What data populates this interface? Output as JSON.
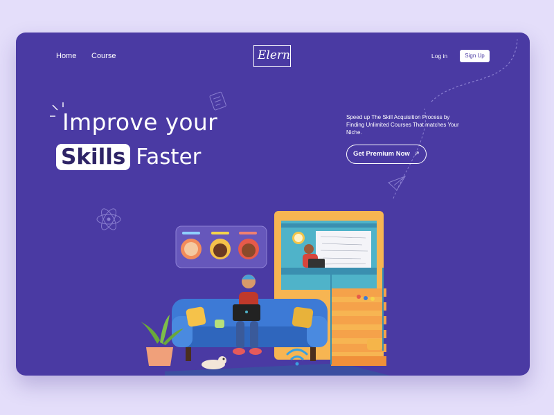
{
  "nav": {
    "home": "Home",
    "course": "Course",
    "logo": "Elern",
    "login": "Log in",
    "signup": "Sign Up"
  },
  "hero": {
    "line1": "Improve your",
    "highlight": "Skills",
    "line2_rest": "Faster",
    "description": "Speed up The Skill Acquisition Process by Finding Unlimited Courses That matches Your Niche.",
    "cta": "Get Premium Now",
    "cta_icon": "arrow-up-right-icon"
  },
  "colors": {
    "page_bg": "#e4defa",
    "card_bg": "#4a3aa3",
    "sofa": "#3d7ad6",
    "monitor": "#f7b552",
    "stairs": "#f5a24a",
    "screen": "#4fb3c9"
  }
}
